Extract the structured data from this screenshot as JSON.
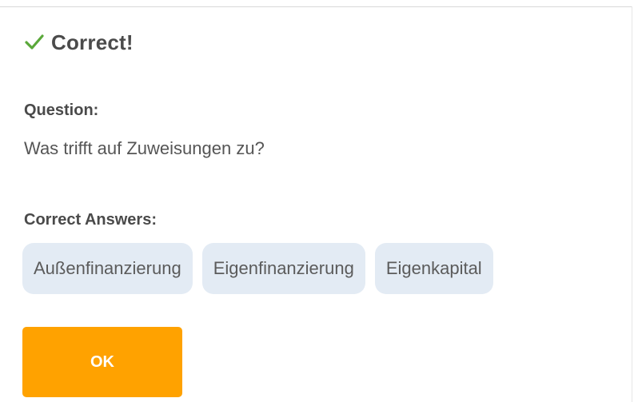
{
  "result": {
    "icon": "check-icon",
    "title": "Correct!",
    "accent_color": "#5aa83a"
  },
  "question": {
    "label": "Question:",
    "text": "Was trifft auf Zuweisungen zu?"
  },
  "answers": {
    "label": "Correct Answers:",
    "items": [
      "Außenfinanzierung",
      "Eigenfinanzierung",
      "Eigenkapital"
    ]
  },
  "actions": {
    "ok_label": "OK",
    "ok_color": "#ffa200"
  }
}
